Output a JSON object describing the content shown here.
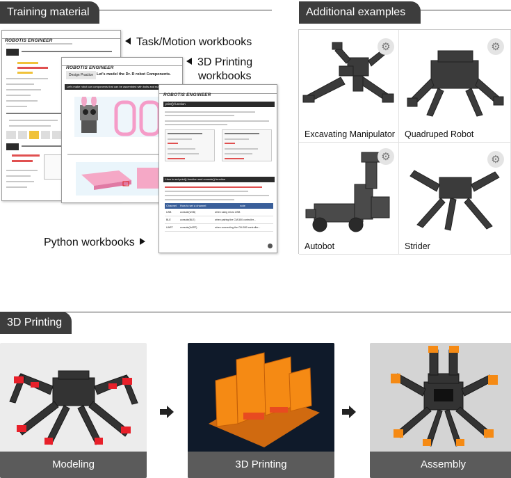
{
  "training": {
    "tab_label": "Training material",
    "brand": "ROBOTIS ENGINEER",
    "captions": {
      "task_motion": "Task/Motion workbooks",
      "printing_line1": "3D Printing",
      "printing_line2": "workbooks",
      "python": "Python workbooks"
    },
    "page2_chip": "Design Practice",
    "page2_title": "Let's model the Dr. R robot Components.",
    "page2_bar": "Let's make robot car components that can be assembled with bolts and nuts to the",
    "page3_heading": "print() function",
    "page3_heading2": "How to set print() function and console() function",
    "page3_table_header": [
      "Channel",
      "How to set a channel",
      "note"
    ],
    "page3_table_rows": [
      [
        "USB",
        "console(USB)",
        "when using micro USB"
      ],
      [
        "BLE",
        "console(BLE)",
        "when pairing the CM-550 controller..."
      ],
      [
        "UART",
        "console(UART)",
        "when connecting the CM-550 controller..."
      ]
    ]
  },
  "examples": {
    "tab_label": "Additional examples",
    "items": [
      {
        "label": "Excavating Manipulator",
        "icon": "gear-icon"
      },
      {
        "label": "Quadruped Robot",
        "icon": "gear-icon"
      },
      {
        "label": "Autobot",
        "icon": "gear-icon"
      },
      {
        "label": "Strider",
        "icon": "gear-icon"
      }
    ]
  },
  "printing": {
    "tab_label": "3D Printing",
    "steps": [
      {
        "label": "Modeling"
      },
      {
        "label": "3D Printing"
      },
      {
        "label": "Assembly"
      }
    ]
  },
  "colors": {
    "tab_bg": "#3d3d3d",
    "accent_red": "#e8202a",
    "print_orange": "#f58a14",
    "footer_grey": "#5b5b5b"
  }
}
